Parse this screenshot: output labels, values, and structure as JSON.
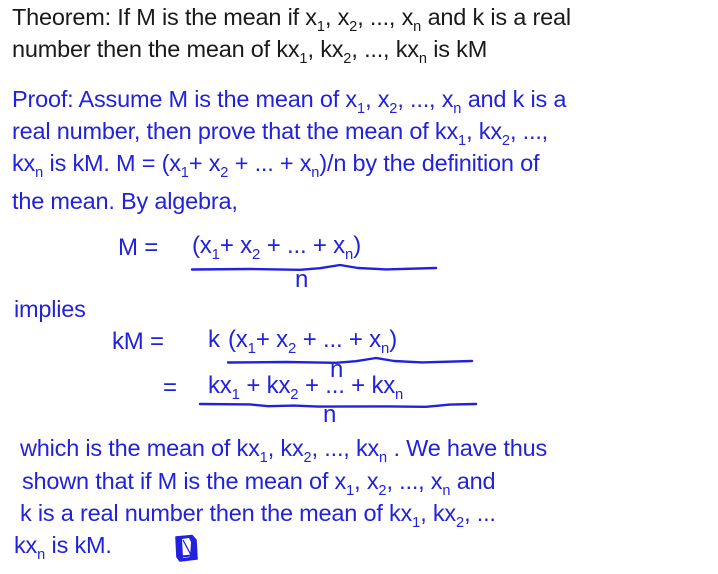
{
  "colors": {
    "background": "#ffffff",
    "theorem_text": "#1a1a1a",
    "proof_text": "#2222dd",
    "rule": "#2222dd"
  },
  "theorem": {
    "line1_a": "Theorem: If M is the mean if x",
    "line1_s1": "1",
    "line1_b": ", x",
    "line1_s2": "2",
    "line1_c": ", ..., x",
    "line1_s3": "n",
    "line1_d": " and k is a real",
    "line2_a": "number then the mean of kx",
    "line2_s1": "1",
    "line2_b": ", kx",
    "line2_s2": "2",
    "line2_c": ", ..., kx",
    "line2_s3": "n",
    "line2_d": " is kM"
  },
  "proof": {
    "line1_a": "Proof: Assume M is the mean of x",
    "line1_s1": "1",
    "line1_b": ", x",
    "line1_s2": "2",
    "line1_c": ", ..., x",
    "line1_s3": "n",
    "line1_d": " and k is a",
    "line2_a": "real number, then prove that the mean of kx",
    "line2_s1": "1",
    "line2_b": ", kx",
    "line2_s2": "2",
    "line2_c": ", ...,",
    "line3_a": "kx",
    "line3_s1": "n",
    "line3_b": " is kM. M = (x",
    "line3_s2": "1",
    "line3_c": "+ x",
    "line3_s3": "2",
    "line3_d": " + ... + x",
    "line3_s4": "n",
    "line3_e": ")/n by the definition of",
    "line4": "the mean. By algebra,"
  },
  "equations": {
    "eq1_lhs": "M =",
    "eq1_numerator_a": "(x",
    "eq1_numerator_s1": "1",
    "eq1_numerator_b": "+ x",
    "eq1_numerator_s2": "2",
    "eq1_numerator_c": " + ... + x",
    "eq1_numerator_s3": "n",
    "eq1_numerator_d": ")",
    "eq1_denominator": "n",
    "implies": "implies",
    "eq2_lhs": "kM =",
    "eq2_coefficient": "k",
    "eq2_numerator_a": "(x",
    "eq2_numerator_s1": "1",
    "eq2_numerator_b": "+ x",
    "eq2_numerator_s2": "2",
    "eq2_numerator_c": " + ... + x",
    "eq2_numerator_s3": "n",
    "eq2_numerator_d": ")",
    "eq2_denominator": "n",
    "eq3_lhs": "=",
    "eq3_numerator_a": "kx",
    "eq3_numerator_s1": "1",
    "eq3_numerator_b": " + kx",
    "eq3_numerator_s2": "2",
    "eq3_numerator_c": " + ... + kx",
    "eq3_numerator_s3": "n",
    "eq3_denominator": "n"
  },
  "conclusion": {
    "line1_a": "which is the mean of kx",
    "line1_s1": "1",
    "line1_b": ", kx",
    "line1_s2": "2",
    "line1_c": ", ..., kx",
    "line1_s3": "n",
    "line1_d": " . We have thus",
    "line2_a": "shown that if M is the mean of x",
    "line2_s1": "1",
    "line2_b": ", x",
    "line2_s2": "2",
    "line2_c": ", ..., x",
    "line2_s3": "n",
    "line2_d": " and",
    "line3_a": "k is a real number then the mean of kx",
    "line3_s1": "1",
    "line3_b": ", kx",
    "line3_s2": "2",
    "line3_c": ", ...",
    "line4_a": "kx",
    "line4_s1": "n",
    "line4_b": " is kM.",
    "qed_symbol": "qed-tombstone"
  }
}
